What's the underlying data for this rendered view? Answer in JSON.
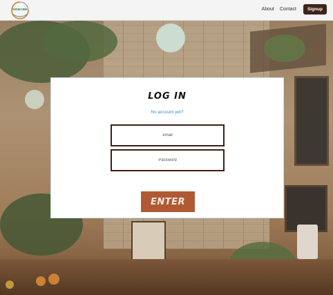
{
  "header": {
    "logo_text": "INDIEVIBE",
    "nav": {
      "about": "About",
      "contact": "Contact",
      "signup": "Signup"
    }
  },
  "login": {
    "title": "LOG IN",
    "no_account_link": "No account yet?",
    "email_placeholder": "email",
    "password_placeholder": "Password",
    "enter_button": "ENTER"
  },
  "colors": {
    "brand_dark": "#3e2419",
    "button_accent": "#b05a34",
    "link_blue": "#2d8fd0",
    "logo_green": "#3a8c5c",
    "logo_orange": "#d9782e"
  }
}
